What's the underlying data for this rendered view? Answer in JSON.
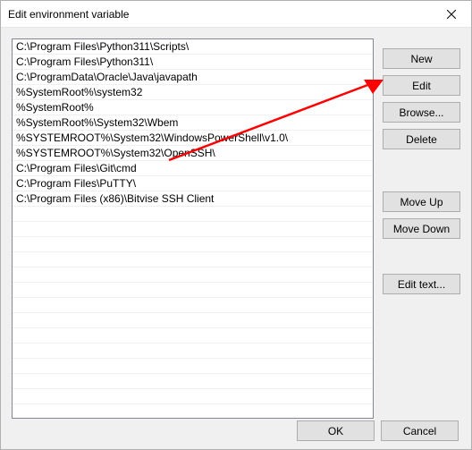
{
  "window": {
    "title": "Edit environment variable"
  },
  "paths": [
    "C:\\Program Files\\Python311\\Scripts\\",
    "C:\\Program Files\\Python311\\",
    "C:\\ProgramData\\Oracle\\Java\\javapath",
    "%SystemRoot%\\system32",
    "%SystemRoot%",
    "%SystemRoot%\\System32\\Wbem",
    "%SYSTEMROOT%\\System32\\WindowsPowerShell\\v1.0\\",
    "%SYSTEMROOT%\\System32\\OpenSSH\\",
    "C:\\Program Files\\Git\\cmd",
    "C:\\Program Files\\PuTTY\\",
    "C:\\Program Files (x86)\\Bitvise SSH Client"
  ],
  "buttons": {
    "new_label": "New",
    "edit_label": "Edit",
    "browse_label": "Browse...",
    "delete_label": "Delete",
    "moveup_label": "Move Up",
    "movedown_label": "Move Down",
    "edittext_label": "Edit text...",
    "ok_label": "OK",
    "cancel_label": "Cancel"
  },
  "annotation": {
    "arrow_color": "#ff0000"
  }
}
